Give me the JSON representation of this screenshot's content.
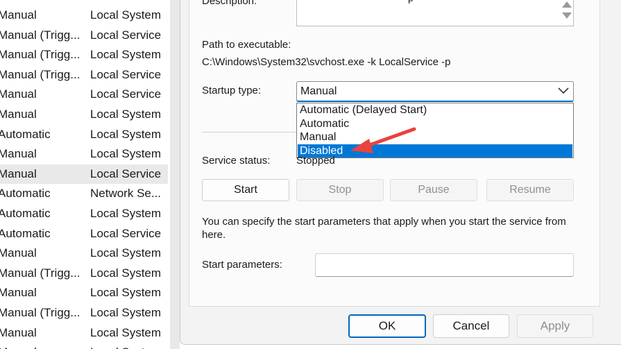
{
  "services_list": [
    {
      "startup": "Manual",
      "logon": "Local System"
    },
    {
      "startup": "Manual (Trigg...",
      "logon": "Local Service"
    },
    {
      "startup": "Manual (Trigg...",
      "logon": "Local System"
    },
    {
      "startup": "Manual (Trigg...",
      "logon": "Local Service"
    },
    {
      "startup": "Manual",
      "logon": "Local Service"
    },
    {
      "startup": "Manual",
      "logon": "Local System"
    },
    {
      "startup": "Automatic",
      "logon": "Local System"
    },
    {
      "startup": "Manual",
      "logon": "Local System"
    },
    {
      "startup": "Manual",
      "logon": "Local Service"
    },
    {
      "startup": "Automatic",
      "logon": "Network Se..."
    },
    {
      "startup": "Automatic",
      "logon": "Local System"
    },
    {
      "startup": "Automatic",
      "logon": "Local Service"
    },
    {
      "startup": "Manual",
      "logon": "Local System"
    },
    {
      "startup": "Manual (Trigg...",
      "logon": "Local System"
    },
    {
      "startup": "Manual",
      "logon": "Local System"
    },
    {
      "startup": "Manual (Trigg...",
      "logon": "Local System"
    },
    {
      "startup": "Manual",
      "logon": "Local System"
    },
    {
      "startup": "Manual",
      "logon": "Local System"
    }
  ],
  "dialog": {
    "description_label": "Description:",
    "description_fragment": "p",
    "path_label": "Path to executable:",
    "path_value": "C:\\Windows\\System32\\svchost.exe -k LocalService -p",
    "startup_type_label": "Startup type:",
    "startup_type_value": "Manual",
    "startup_options": [
      {
        "label": "Automatic (Delayed Start)",
        "selected": false
      },
      {
        "label": "Automatic",
        "selected": false
      },
      {
        "label": "Manual",
        "selected": false
      },
      {
        "label": "Disabled",
        "selected": true
      }
    ],
    "service_status_label": "Service status:",
    "service_status_value": "Stopped",
    "buttons": {
      "start": "Start",
      "stop": "Stop",
      "pause": "Pause",
      "resume": "Resume"
    },
    "hint": "You can specify the start parameters that apply when you start the service from here.",
    "start_parameters_label": "Start parameters:",
    "start_parameters_value": "",
    "footer": {
      "ok": "OK",
      "cancel": "Cancel",
      "apply": "Apply"
    }
  },
  "colors": {
    "accent": "#0067c0",
    "selection": "#0078d7",
    "annotation_arrow": "#e8433f"
  }
}
